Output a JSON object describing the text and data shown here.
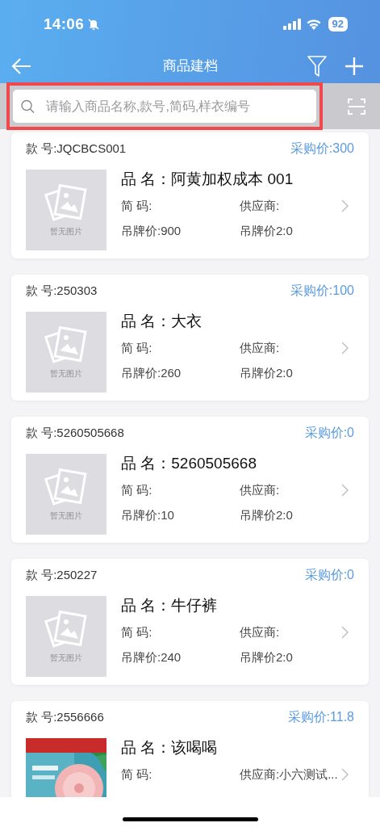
{
  "status_bar": {
    "time": "14:06",
    "battery": "92"
  },
  "nav_bar": {
    "title": "商品建档"
  },
  "search": {
    "placeholder": "请输入商品名称,款号,简码,样衣编号",
    "highlighted": true
  },
  "products": [
    {
      "style_no": "款 号:JQCBCS001",
      "purchase_price": "采购价:300",
      "image": {
        "kind": "placeholder",
        "caption": "暂无图片"
      },
      "name": "品 名：阿黄加权成本 001",
      "short_code": "简 码:",
      "supplier": "供应商:",
      "tag_price": "吊牌价:900",
      "tag_price_2": "吊牌价2:0"
    },
    {
      "style_no": "款 号:250303",
      "purchase_price": "采购价:100",
      "image": {
        "kind": "placeholder",
        "caption": "暂无图片"
      },
      "name": "品 名：大衣",
      "short_code": "简 码:",
      "supplier": "供应商:",
      "tag_price": "吊牌价:260",
      "tag_price_2": "吊牌价2:0"
    },
    {
      "style_no": "款 号:5260505668",
      "purchase_price": "采购价:0",
      "image": {
        "kind": "placeholder",
        "caption": "暂无图片"
      },
      "name": "品 名：5260505668",
      "short_code": "简 码:",
      "supplier": "供应商:",
      "tag_price": "吊牌价:10",
      "tag_price_2": "吊牌价2:0"
    },
    {
      "style_no": "款 号:250227",
      "purchase_price": "采购价:0",
      "image": {
        "kind": "placeholder",
        "caption": "暂无图片"
      },
      "name": "品 名：牛仔裤",
      "short_code": "简 码:",
      "supplier": "供应商:",
      "tag_price": "吊牌价:240",
      "tag_price_2": "吊牌价2:0"
    },
    {
      "style_no": "款 号:2556666",
      "purchase_price": "采购价:11.8",
      "name": "品 名：该喝喝",
      "short_code": "简 码:",
      "supplier": "供应商:小六测试..."
    }
  ]
}
